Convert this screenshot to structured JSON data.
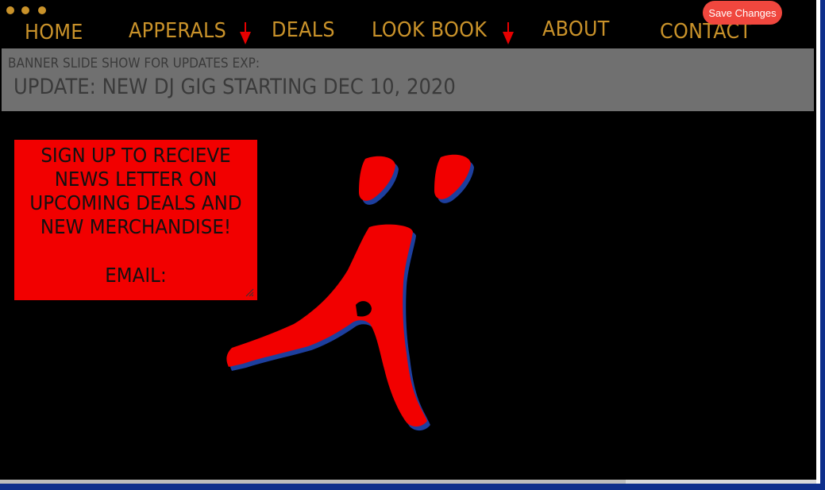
{
  "nav": {
    "items": [
      {
        "label": "HOME"
      },
      {
        "label": "APPERALS"
      },
      {
        "label": "DEALS"
      },
      {
        "label": "LOOK BOOK"
      },
      {
        "label": "ABOUT"
      },
      {
        "label": "CONTACT"
      }
    ],
    "dropdown_icon": "down-arrow-icon",
    "save_label": "Save Changes"
  },
  "banner": {
    "label": "BANNER SLIDE SHOW FOR UPDATES EXP:",
    "update": "UPDATE: NEW DJ GIG STARTING DEC 10, 2020"
  },
  "signup": {
    "message": "SIGN UP TO RECIEVE NEWS LETTER ON UPCOMING DEALS AND NEW MERCHANDISE!",
    "email_label": "EMAIL:"
  },
  "logo": {
    "icon": "a-umlaut-logo"
  },
  "colors": {
    "page_bg": "#000000",
    "nav_text": "#c9922a",
    "dot": "#c9922a",
    "arrow": "#e60000",
    "save_button": "#f0473e",
    "banner_bg": "#707070",
    "banner_text": "#3a3a3a",
    "signup_bg": "#f20000",
    "logo_red": "#f20000",
    "logo_shadow": "#1d3f9e"
  }
}
